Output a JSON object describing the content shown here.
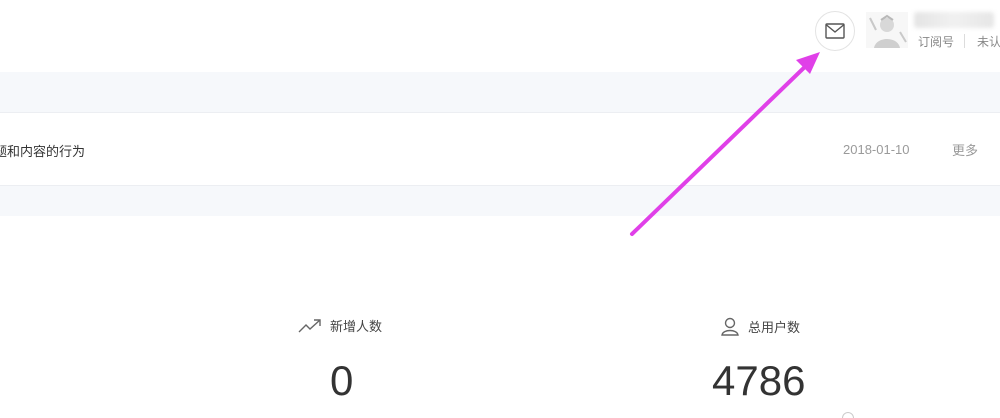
{
  "header": {
    "mail_icon": "envelope-icon",
    "account_type": "订阅号",
    "verify_status": "未认"
  },
  "notice": {
    "text": "题和内容的行为",
    "date": "2018-01-10",
    "more_label": "更多"
  },
  "stats": [
    {
      "icon": "trend-up-icon",
      "label": "新增人数",
      "value": "0"
    },
    {
      "icon": "user-icon",
      "label": "总用户数",
      "value": "4786"
    }
  ],
  "annotation": {
    "color": "#e040e8"
  }
}
